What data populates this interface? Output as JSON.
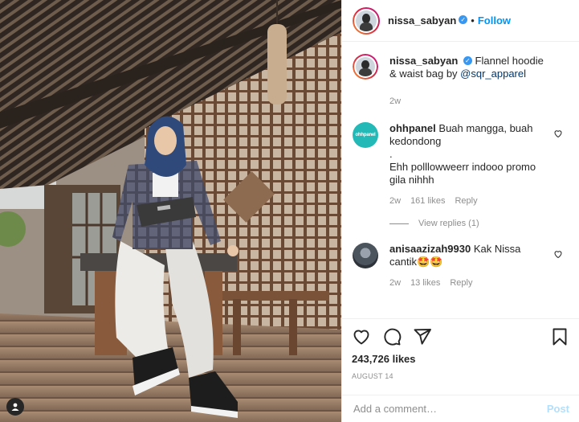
{
  "post": {
    "author": "nissa_sabyan",
    "header_separator": "•",
    "follow_label": "Follow",
    "caption_text": "Flannel hoodie & waist bag by ",
    "caption_mention": "@sqr_apparel",
    "caption_time": "2w",
    "likes": "243,726 likes",
    "date": "AUGUST 14"
  },
  "comments": [
    {
      "user": "ohhpanel",
      "avatar_label": "ohhpanel",
      "lines": [
        "Buah mangga, buah kedondong",
        ".",
        "Ehh polllowweerr indooo promo gila nihhh"
      ],
      "time": "2w",
      "likes": "161 likes",
      "reply_label": "Reply",
      "view_replies": "View replies (1)"
    },
    {
      "user": "anisaazizah9930",
      "text": "Kak Nissa cantik🤩🤩",
      "time": "2w",
      "likes": "13 likes",
      "reply_label": "Reply"
    }
  ],
  "comment_box": {
    "placeholder": "Add a comment…",
    "post_label": "Post"
  },
  "icons": {
    "like": "heart-icon",
    "comment": "comment-icon",
    "share": "share-icon",
    "save": "bookmark-icon",
    "verified": "verified-badge-icon",
    "tagged_user": "user-tag-icon"
  },
  "colors": {
    "link": "#0095f6",
    "verified": "#3897f0",
    "muted": "#8e8e8e",
    "post_disabled": "#b2dffc"
  }
}
